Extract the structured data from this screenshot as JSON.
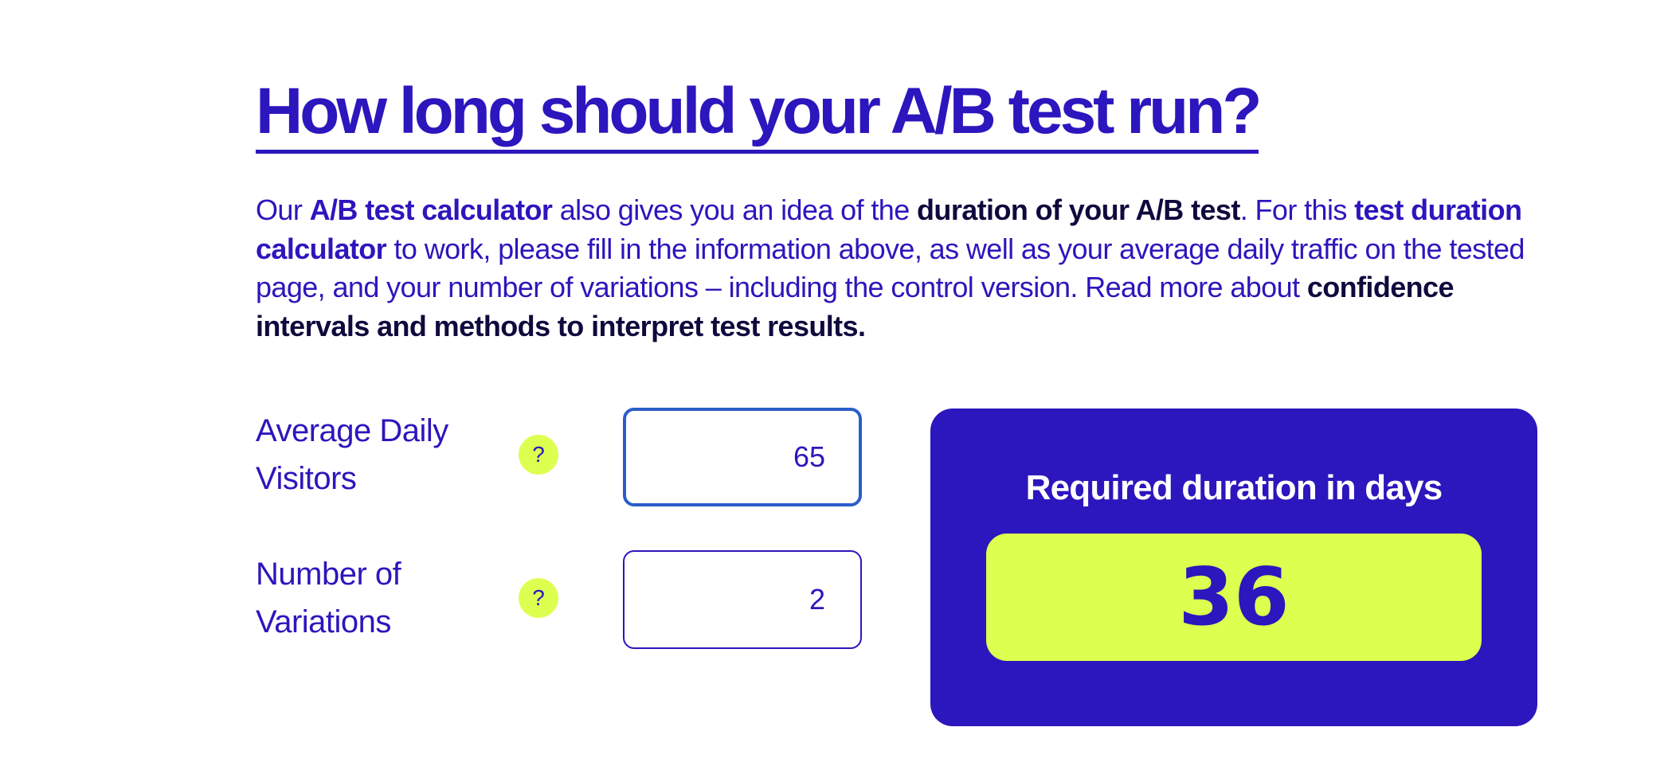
{
  "heading": "How long should your A/B test run?",
  "intro": {
    "t1": "Our ",
    "b1": "A/B test calculator",
    "t2": " also gives you an idea of the ",
    "b2": "duration of your A/B test",
    "t3": ". For this ",
    "b3": "test duration calculator",
    "t4": " to work, please fill in the information above, as well as your average daily traffic on the tested page, and your number of variations – including the control version. Read more about ",
    "link": "confidence intervals and methods to interpret test results."
  },
  "fields": {
    "visitors": {
      "label": "Average Daily Visitors",
      "help": "?",
      "value": "65"
    },
    "variations": {
      "label": "Number of Variations",
      "help": "?",
      "value": "2"
    }
  },
  "result": {
    "title": "Required duration in days",
    "value": "36"
  },
  "colors": {
    "primary": "#2c16bd",
    "accent": "#ddff4f",
    "focus_border": "#2a5dc9",
    "link_dark": "#0f0a3d"
  }
}
